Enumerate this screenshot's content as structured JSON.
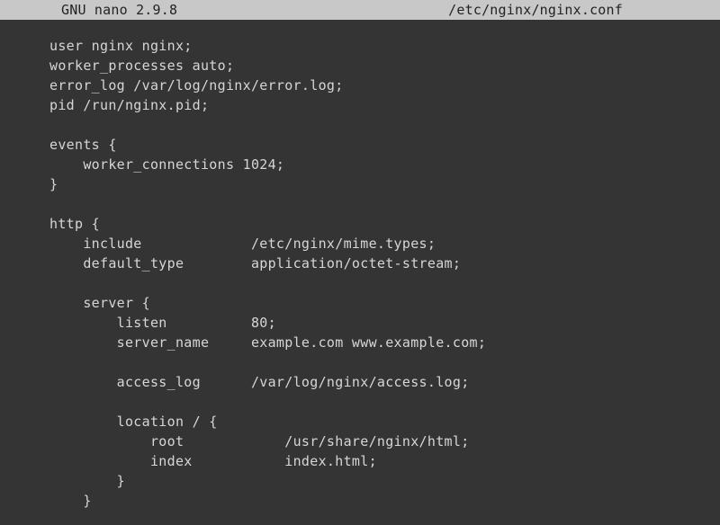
{
  "titlebar": {
    "app_name": "GNU nano 2.9.8",
    "file_path": "/etc/nginx/nginx.conf"
  },
  "editor": {
    "lines": [
      "user nginx nginx;",
      "worker_processes auto;",
      "error_log /var/log/nginx/error.log;",
      "pid /run/nginx.pid;",
      "",
      "events {",
      "    worker_connections 1024;",
      "}",
      "",
      "http {",
      "    include             /etc/nginx/mime.types;",
      "    default_type        application/octet-stream;",
      "",
      "    server {",
      "        listen          80;",
      "        server_name     example.com www.example.com;",
      "",
      "        access_log      /var/log/nginx/access.log;",
      "",
      "        location / {",
      "            root            /usr/share/nginx/html;",
      "            index           index.html;",
      "        }",
      "    }"
    ]
  }
}
